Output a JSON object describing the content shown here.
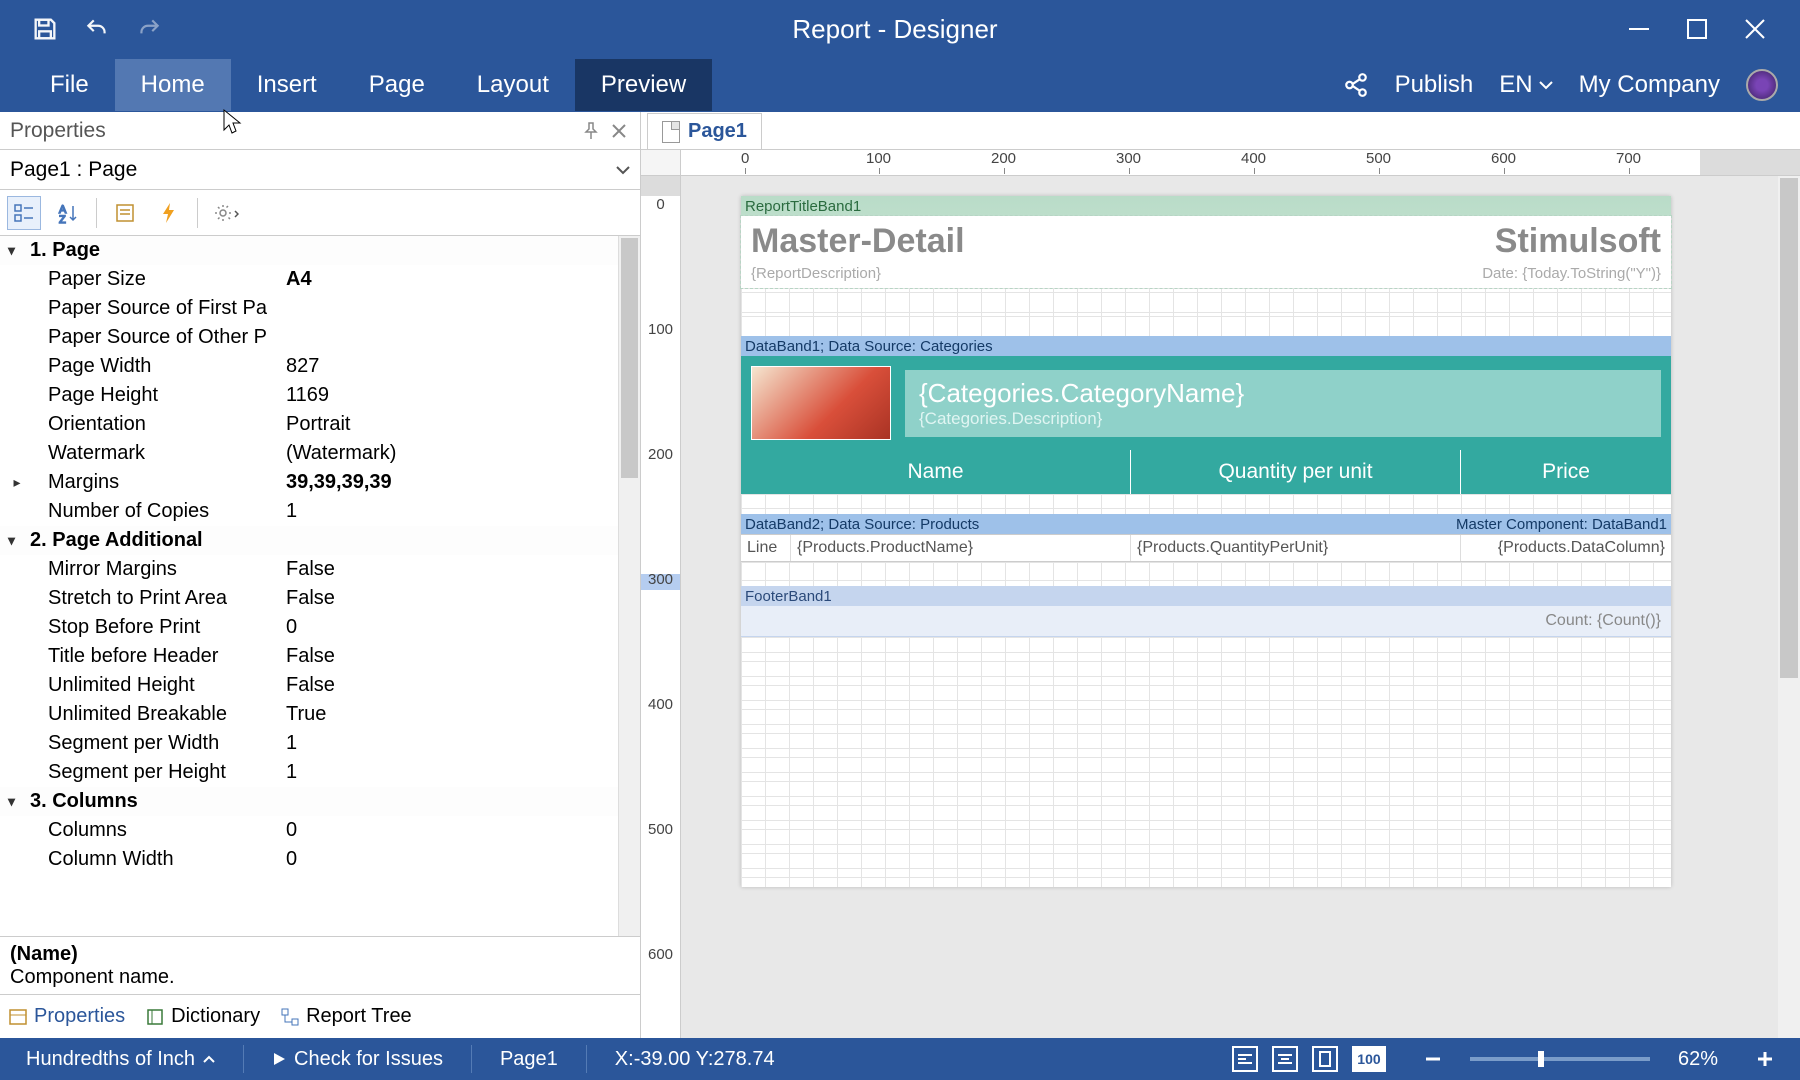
{
  "titlebar": {
    "title": "Report - Designer"
  },
  "ribbon": {
    "tabs": [
      "File",
      "Home",
      "Insert",
      "Page",
      "Layout",
      "Preview"
    ],
    "publish": "Publish",
    "lang": "EN",
    "company": "My Company"
  },
  "properties": {
    "title": "Properties",
    "selector": "Page1 : Page",
    "groups": [
      {
        "label": "1. Page",
        "rows": [
          {
            "name": "Paper Size",
            "value": "A4",
            "bold": true
          },
          {
            "name": "Paper Source of First Pa",
            "value": ""
          },
          {
            "name": "Paper Source of Other P",
            "value": ""
          },
          {
            "name": "Page Width",
            "value": "827"
          },
          {
            "name": "Page Height",
            "value": "1169"
          },
          {
            "name": "Orientation",
            "value": "Portrait"
          },
          {
            "name": "Watermark",
            "value": "(Watermark)"
          },
          {
            "name": "Margins",
            "value": "39,39,39,39",
            "bold": true,
            "expand": true
          },
          {
            "name": "Number of Copies",
            "value": "1"
          }
        ]
      },
      {
        "label": "2. Page  Additional",
        "rows": [
          {
            "name": "Mirror Margins",
            "value": "False"
          },
          {
            "name": "Stretch to Print Area",
            "value": "False"
          },
          {
            "name": "Stop Before Print",
            "value": "0"
          },
          {
            "name": "Title before Header",
            "value": "False"
          },
          {
            "name": "Unlimited Height",
            "value": "False"
          },
          {
            "name": "Unlimited Breakable",
            "value": "True"
          },
          {
            "name": "Segment per Width",
            "value": "1"
          },
          {
            "name": "Segment per Height",
            "value": "1"
          }
        ]
      },
      {
        "label": "3. Columns",
        "rows": [
          {
            "name": "Columns",
            "value": "0"
          },
          {
            "name": "Column Width",
            "value": "0"
          }
        ]
      }
    ],
    "desc": {
      "name": "(Name)",
      "text": "Component name."
    },
    "bottomTabs": [
      "Properties",
      "Dictionary",
      "Report Tree"
    ]
  },
  "pageTab": "Page1",
  "ruler": {
    "h": [
      "0",
      "100",
      "200",
      "300",
      "400",
      "500",
      "600",
      "700"
    ],
    "v": [
      "0",
      "100",
      "200",
      "300",
      "400",
      "500",
      "600"
    ]
  },
  "report": {
    "titleBand": {
      "label": "ReportTitleBand1",
      "heading": "Master-Detail",
      "brand": "Stimulsoft",
      "desc": "{ReportDescription}",
      "date": "Date: {Today.ToString(\"Y\")}"
    },
    "dataBand1": {
      "label": "DataBand1; Data Source: Categories",
      "catName": "{Categories.CategoryName}",
      "catDesc": "{Categories.Description}",
      "cols": [
        "Name",
        "Quantity per unit",
        "Price"
      ]
    },
    "dataBand2": {
      "labelLeft": "DataBand2; Data Source: Products",
      "labelRight": "Master Component: DataBand1",
      "line": "Line",
      "c1": "{Products.ProductName}",
      "c2": "{Products.QuantityPerUnit}",
      "c3": "{Products.DataColumn}"
    },
    "footer": {
      "label": "FooterBand1",
      "count": "Count: {Count()}"
    }
  },
  "status": {
    "units": "Hundredths of Inch",
    "check": "Check for Issues",
    "page": "Page1",
    "coords": "X:-39.00 Y:278.74",
    "zoom": "62%"
  }
}
